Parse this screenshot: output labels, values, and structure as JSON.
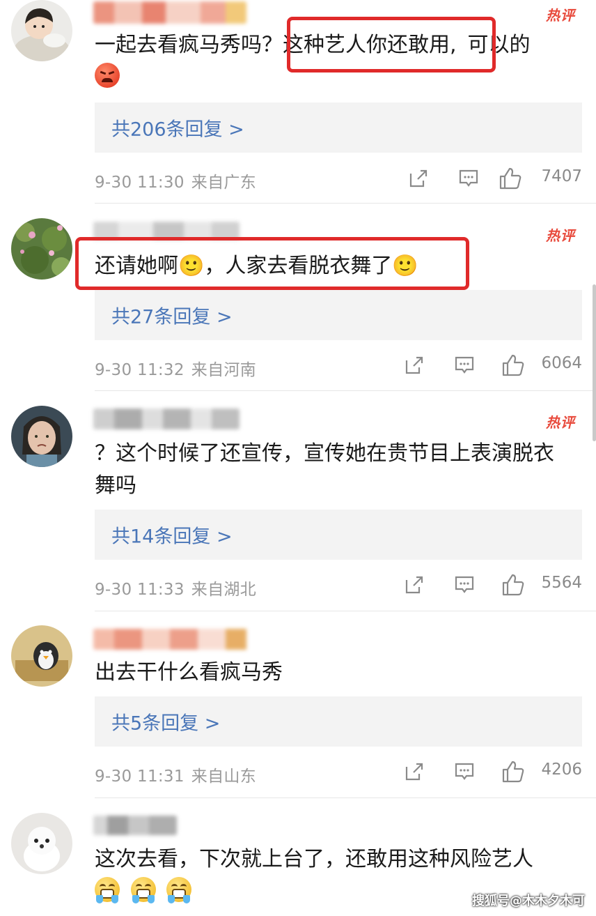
{
  "hot_label": "热评",
  "accent_color": "#e02a2a",
  "link_color": "#4a76b8",
  "comments": [
    {
      "avatar": "avatar-child",
      "text_before": "一起去看疯马秀吗？",
      "text_highlight": "这种艺人你还敢用,",
      "text_after": "可以的",
      "emoji": [
        "angry-face"
      ],
      "replies": "共206条回复 >",
      "time": "9-30 11:30",
      "location": "来自广东",
      "likes": "7407"
    },
    {
      "avatar": "avatar-lotus",
      "text_highlight": "还请她啊🙂，人家去看脱衣舞了🙂",
      "emoji": [
        "smile-face",
        "smile-face"
      ],
      "replies": "共27条回复 >",
      "time": "9-30 11:32",
      "location": "来自河南",
      "likes": "6064"
    },
    {
      "avatar": "avatar-person",
      "text": "？这个时候了还宣传，宣传她在贵节目上表演脱衣舞吗",
      "replies": "共14条回复 >",
      "time": "9-30 11:33",
      "location": "来自湖北",
      "likes": "5564"
    },
    {
      "avatar": "avatar-penguin",
      "text": "出去干什么看疯马秀",
      "replies": "共5条回复 >",
      "time": "9-30 11:31",
      "location": "来自山东",
      "likes": "4206"
    },
    {
      "avatar": "avatar-dog",
      "text": "这次去看，下次就上台了，还敢用这种风险艺人",
      "emoji": [
        "crying-face",
        "crying-face",
        "crying-face"
      ]
    }
  ],
  "watermark": "搜狐号@木木夕木可"
}
